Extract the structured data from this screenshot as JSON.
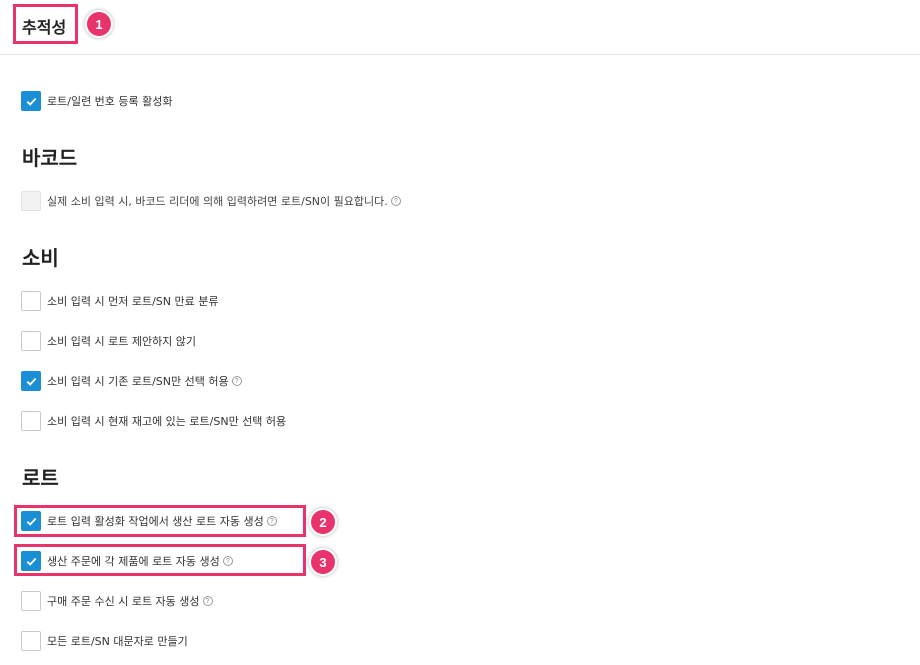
{
  "annotations": {
    "badge1": "1",
    "badge2": "2",
    "badge3": "3"
  },
  "colors": {
    "accent": "#1a8fd6",
    "highlight": "#e8336b"
  },
  "page": {
    "title": "추적성"
  },
  "traceability": {
    "enable_lot_serial": {
      "label": "로트/일련 번호 등록 활성화",
      "checked": true
    }
  },
  "barcode": {
    "title": "바코드",
    "require_lot_sn": {
      "label": "실제 소비 입력 시, 바코드 리더에 의해 입력하려면 로트/SN이 필요합니다.",
      "checked": false,
      "disabled": true,
      "help_icon": "question-circle"
    }
  },
  "consumption": {
    "title": "소비",
    "items": [
      {
        "label": "소비 입력 시 먼저 로트/SN 만료 분류",
        "checked": false
      },
      {
        "label": "소비 입력 시 로트 제안하지 않기",
        "checked": false
      },
      {
        "label": "소비 입력 시 기존 로트/SN만 선택 허용",
        "checked": true,
        "help_icon": "question-circle"
      },
      {
        "label": "소비 입력 시 현재 재고에 있는 로트/SN만 선택 허용",
        "checked": false
      }
    ]
  },
  "lot": {
    "title": "로트",
    "items": [
      {
        "label": "로트 입력 활성화 작업에서 생산 로트 자동 생성",
        "checked": true,
        "help_icon": "question-circle"
      },
      {
        "label": "생산 주문에 각 제품에 로트 자동 생성",
        "checked": true,
        "help_icon": "question-circle"
      },
      {
        "label": "구매 주문 수신 시 로트 자동 생성",
        "checked": false,
        "help_icon": "question-circle"
      },
      {
        "label": "모든 로트/SN 대문자로 만들기",
        "checked": false
      }
    ]
  }
}
